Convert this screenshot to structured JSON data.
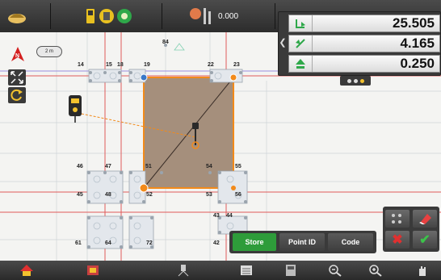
{
  "top_bar": {
    "items": [
      {
        "name": "rover-icon"
      },
      {
        "name": "controller-status-icons"
      },
      {
        "name": "target-height-icon",
        "value": "0.000"
      }
    ]
  },
  "measurements": {
    "rows": [
      {
        "icon": "delta-east-icon",
        "value": "25.505"
      },
      {
        "icon": "delta-north-icon",
        "value": "4.165"
      },
      {
        "icon": "delta-height-icon",
        "value": "0.250"
      }
    ],
    "pages": 3,
    "active_page": 3
  },
  "map": {
    "scale_label": "2 m",
    "north_label": "N",
    "point_labels": [
      "84",
      "14",
      "15",
      "18",
      "19",
      "22",
      "23",
      "46",
      "47",
      "51",
      "54",
      "55",
      "45",
      "48",
      "52",
      "53",
      "56",
      "43",
      "44",
      "61",
      "64",
      "72",
      "42"
    ]
  },
  "actions": {
    "store_label": "Store",
    "point_id_label": "Point ID",
    "code_label": "Code",
    "accent": "#2e9c3a"
  },
  "mini_panel": {
    "items": [
      "point-settings-icon",
      "eraser-icon",
      "cancel-icon",
      "confirm-icon"
    ]
  },
  "bottom_bar": {
    "items": [
      "home-icon",
      "map-layers-icon",
      "instrument-icon",
      "list-icon",
      "calculator-icon",
      "zoom-out-icon",
      "zoom-in-icon",
      "pan-icon"
    ]
  },
  "colors": {
    "selection": "#a58f7c",
    "selection_border": "#f28a1a",
    "grid_red": "#e05a5a",
    "grid_purple": "#9a8ee0"
  }
}
